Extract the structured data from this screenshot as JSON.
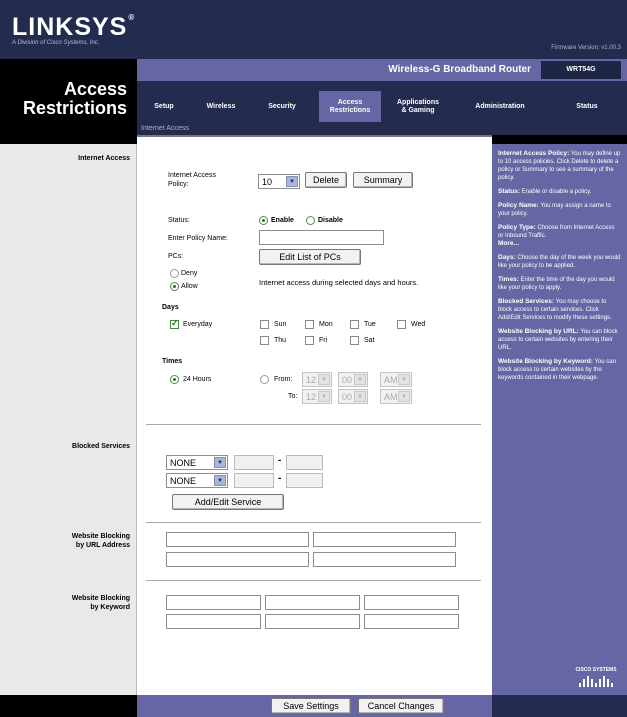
{
  "brand": {
    "logo": "LINKSYS",
    "logo_mark": "®",
    "tagline": "A Division of Cisco Systems, Inc.",
    "firmware": "Firmware Version: v1.00.3"
  },
  "header": {
    "product_name": "Wireless-G Broadband Router",
    "model": "WRT54G",
    "page_title": "Access Restrictions"
  },
  "nav": {
    "tabs": [
      {
        "label": "Setup"
      },
      {
        "label": "Wireless"
      },
      {
        "label": "Security"
      },
      {
        "label": "Access\nRestrictions"
      },
      {
        "label": "Applications\n& Gaming"
      },
      {
        "label": "Administration"
      },
      {
        "label": "Status"
      }
    ],
    "subnav": "Internet Access"
  },
  "sections": {
    "internet_access": "Internet Access",
    "blocked_services": "Blocked Services",
    "website_url": "Website Blocking\nby URL Address",
    "website_keyword": "Website Blocking\nby Keyword"
  },
  "form": {
    "policy_label": "Internet Access\nPolicy:",
    "policy_value": "10",
    "delete_button": "Delete",
    "summary_button": "Summary",
    "status_label": "Status:",
    "status_enable": "Enable",
    "status_disable": "Disable",
    "policy_name_label": "Enter Policy Name:",
    "policy_name_value": "",
    "pcs_label": "PCs:",
    "edit_pcs_button": "Edit List of PCs",
    "deny_label": "Deny",
    "allow_label": "Allow",
    "allow_desc": "Internet access during selected days and hours.",
    "days_label": "Days",
    "everyday": "Everyday",
    "days": [
      "Sun",
      "Mon",
      "Tue",
      "Wed",
      "Thu",
      "Fri",
      "Sat"
    ],
    "times_label": "Times",
    "hours24": "24 Hours",
    "from_label": "From:",
    "to_label": "To:",
    "from_values": [
      "12",
      "00",
      "AM"
    ],
    "to_values": [
      "12",
      "00",
      "AM"
    ],
    "service_1": "NONE",
    "service_2": "NONE",
    "add_edit_service": "Add/Edit Service",
    "save_button": "Save Settings",
    "cancel_button": "Cancel Changes"
  },
  "help": {
    "blocks": [
      {
        "title": "Internet Access Policy:",
        "text": "You may define up to 10 access policies. Click Delete to delete a policy or Summary to see a summary of the policy."
      },
      {
        "title": "Status:",
        "text": "Enable or disable a policy."
      },
      {
        "title": "Policy Name:",
        "text": "You may assign a name to your policy."
      },
      {
        "title": "Policy Type:",
        "text": "Choose from Internet Access or Inbound Traffic."
      },
      {
        "title": "More...",
        "text": ""
      },
      {
        "title": "Days:",
        "text": "Choose the day of the week you would like your policy to be applied."
      },
      {
        "title": "Times:",
        "text": "Enter the time of the day you would like your policy to apply."
      },
      {
        "title": "Blocked Services:",
        "text": "You may choose to block access to certain services. Click Add/Edit Services to modify these settings."
      },
      {
        "title": "Website Blocking by URL:",
        "text": "You can block access to certain websites by entering their URL."
      },
      {
        "title": "Website Blocking by Keyword:",
        "text": "You can block access to certain websites by the keywords contained in their webpage."
      }
    ],
    "cisco_label": "CISCO SYSTEMS"
  },
  "colors": {
    "navy": "#232c4f",
    "purple": "#6666a4",
    "black": "#000000"
  }
}
